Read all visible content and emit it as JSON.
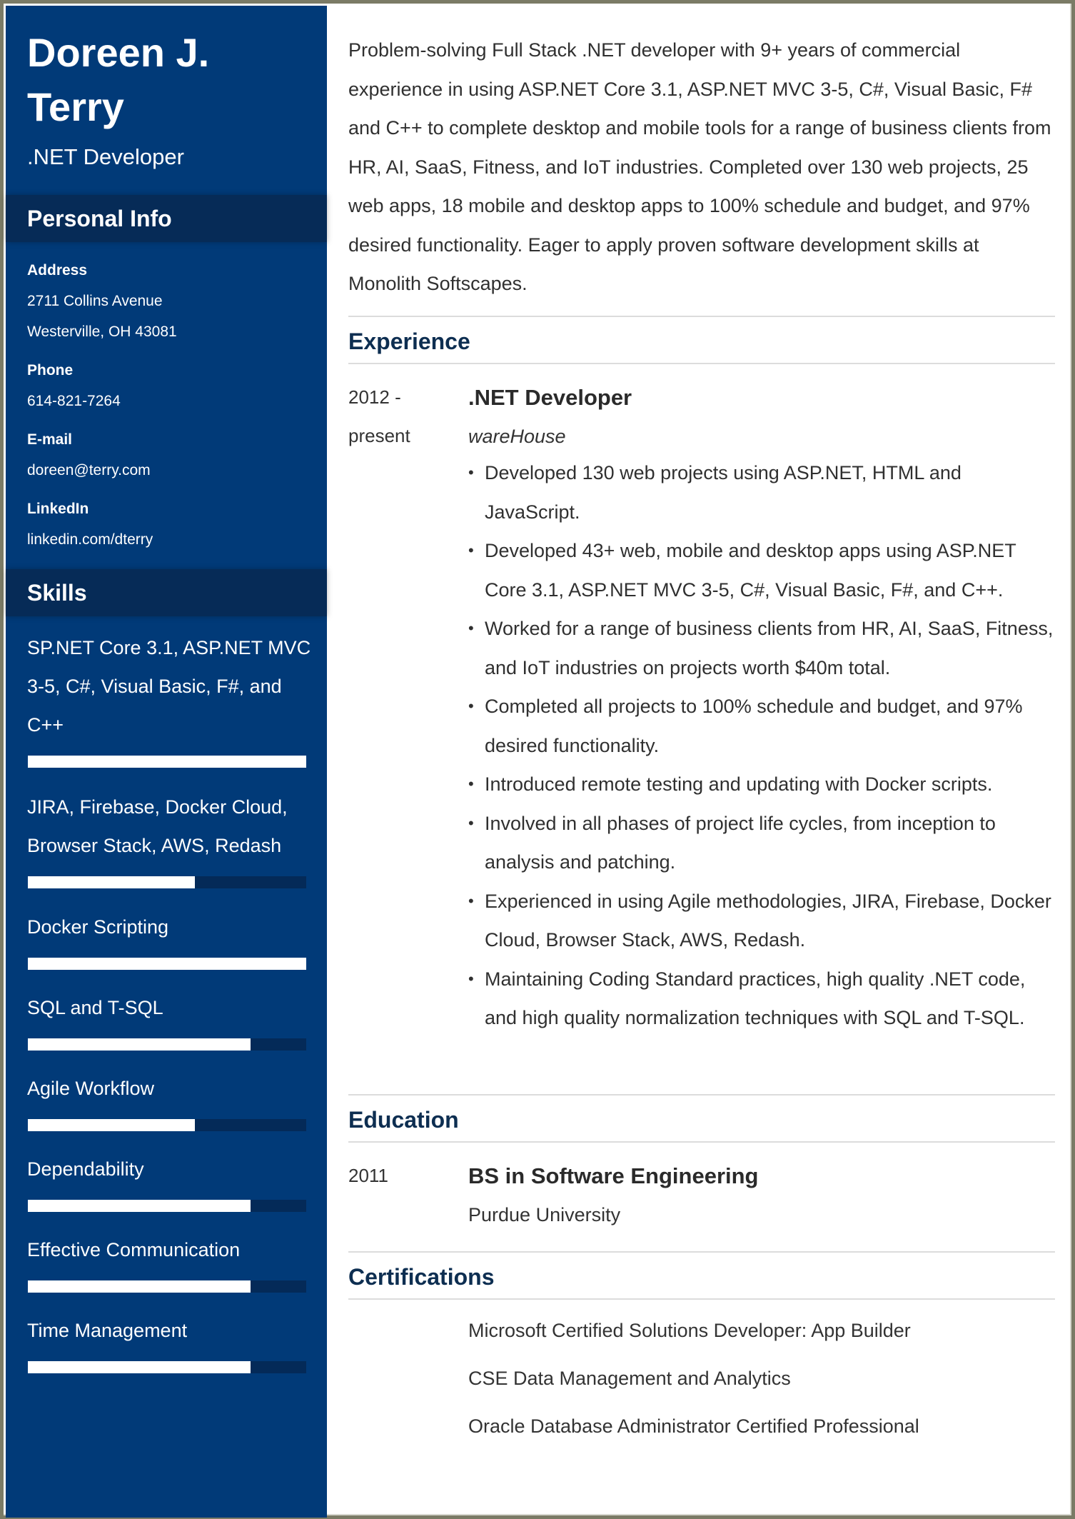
{
  "colors": {
    "sidebar_bg": "#013a78",
    "sidebar_header_bg": "#062b57",
    "section_title": "#0d2e51",
    "body_text": "#303030",
    "frame_border": "#7b7b66"
  },
  "header": {
    "name": "Doreen J. Terry",
    "title": ".NET Developer"
  },
  "personal_info": {
    "heading": "Personal Info",
    "address_label": "Address",
    "address_line1": "2711 Collins Avenue",
    "address_line2": "Westerville, OH 43081",
    "phone_label": "Phone",
    "phone": "614-821-7264",
    "email_label": "E-mail",
    "email": "doreen@terry.com",
    "linkedin_label": "LinkedIn",
    "linkedin": "linkedin.com/dterry"
  },
  "skills": {
    "heading": "Skills",
    "items": [
      {
        "name": "SP.NET Core 3.1, ASP.NET MVC 3-5, C#, Visual Basic, F#, and C++",
        "level": 1.0
      },
      {
        "name": "JIRA, Firebase, Docker Cloud, Browser Stack, AWS, Redash",
        "level": 0.6
      },
      {
        "name": "Docker Scripting",
        "level": 1.0
      },
      {
        "name": "SQL and T-SQL",
        "level": 0.8
      },
      {
        "name": "Agile Workflow",
        "level": 0.6
      },
      {
        "name": "Dependability",
        "level": 0.8
      },
      {
        "name": "Effective Communication",
        "level": 0.8
      },
      {
        "name": "Time Management",
        "level": 0.8
      }
    ]
  },
  "summary": "Problem-solving Full Stack .NET developer with 9+ years of commercial experience in using ASP.NET Core 3.1, ASP.NET MVC 3-5, C#, Visual Basic, F# and C++ to complete desktop and mobile tools for a range of business clients from HR, AI, SaaS, Fitness, and IoT industries. Completed over 130 web projects, 25 web apps, 18 mobile and desktop apps to 100% schedule and budget, and 97% desired functionality. Eager to apply proven software development skills at Monolith Softscapes.",
  "experience": {
    "heading": "Experience",
    "entries": [
      {
        "date_start": "2012 -",
        "date_end": "present",
        "title": ".NET Developer",
        "company": "wareHouse",
        "bullets": [
          "Developed 130 web projects using ASP.NET, HTML and JavaScript.",
          "Developed 43+ web, mobile and desktop apps using ASP.NET Core 3.1, ASP.NET MVC 3-5, C#, Visual Basic, F#, and C++.",
          "Worked for a range of business clients from HR, AI, SaaS, Fitness, and IoT industries on projects worth $40m total.",
          "Completed all projects to 100% schedule and budget, and 97% desired functionality.",
          "Introduced remote testing and updating with Docker scripts.",
          "Involved in all phases of project life cycles, from inception to analysis and patching.",
          "Experienced in using Agile methodologies, JIRA, Firebase, Docker Cloud, Browser Stack, AWS, Redash.",
          "Maintaining Coding Standard practices, high quality .NET code, and high quality normalization techniques with SQL and T-SQL."
        ]
      }
    ]
  },
  "education": {
    "heading": "Education",
    "entries": [
      {
        "date": "2011",
        "degree": "BS in Software Engineering",
        "school": "Purdue University"
      }
    ]
  },
  "certifications": {
    "heading": "Certifications",
    "items": [
      "Microsoft Certified Solutions Developer: App Builder",
      "CSE Data Management and Analytics",
      "Oracle Database Administrator Certified Professional"
    ]
  }
}
